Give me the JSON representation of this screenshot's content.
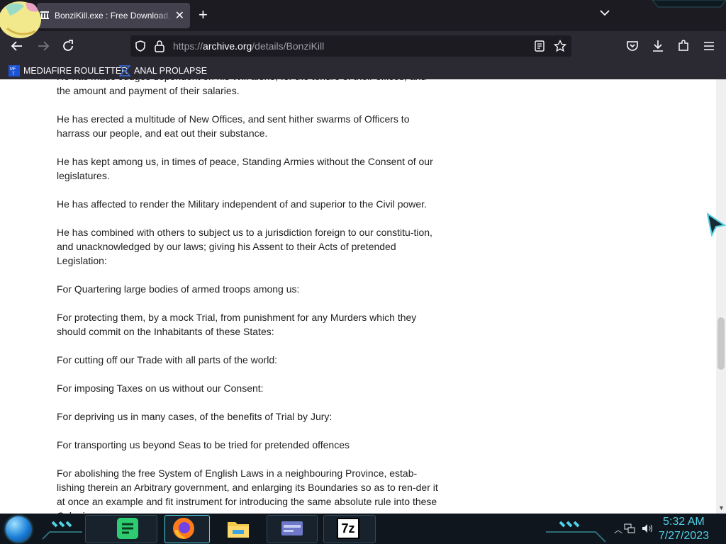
{
  "browser": {
    "tab_title": "BonziKill.exe : Free Download, Borrow",
    "url_prefix": "https://",
    "url_domain": "archive.org",
    "url_path": "/details/BonziKill"
  },
  "bookmarks": [
    {
      "label": "MEDIAFIRE ROULETTER",
      "icon": "mediafire-icon"
    },
    {
      "label": "ANAL PROLAPSE",
      "icon": "bookmark-icon"
    }
  ],
  "article": {
    "paragraphs": [
      "He has made Judges dependent on his Will alone, for the tenure of their offices, and the amount and payment of their salaries.",
      "He has erected a multitude of New Offices, and sent hither swarms of Officers to harrass our people, and eat out their substance.",
      "He has kept among us, in times of peace, Standing Armies without the Consent of our legislatures.",
      "He has affected to render the Military independent of and superior to the Civil power.",
      "He has combined with others to subject us to a jurisdiction foreign to our constitu-tion, and unacknowledged by our laws; giving his Assent to their Acts of pretended Legislation:",
      "For Quartering large bodies of armed troops among us:",
      "For protecting them, by a mock Trial, from punishment for any Murders which they should commit on the Inhabitants of these States:",
      "For cutting off our Trade with all parts of the world:",
      "For imposing Taxes on us without our Consent:",
      "For depriving us in many cases, of the benefits of Trial by Jury:",
      "For transporting us beyond Seas to be tried for pretended offences",
      "For abolishing the free System of English Laws in a neighbouring Province, estab-lishing therein an Arbitrary government, and enlarging its Boundaries so as to ren-der it at once an example and fit instrument for introducing the same absolute rule into these Colonies:"
    ]
  },
  "taskbar": {
    "apps": [
      "notes-app-icon",
      "firefox-icon",
      "file-explorer-icon",
      "control-panel-icon",
      "7zip-icon"
    ],
    "seven_zip_label": "7z",
    "time": "5:32 AM",
    "date": "7/27/2023"
  },
  "colors": {
    "chrome_dark": "#1c1b22",
    "chrome": "#2b2a33",
    "accent_cyan": "#4fd1e6"
  }
}
